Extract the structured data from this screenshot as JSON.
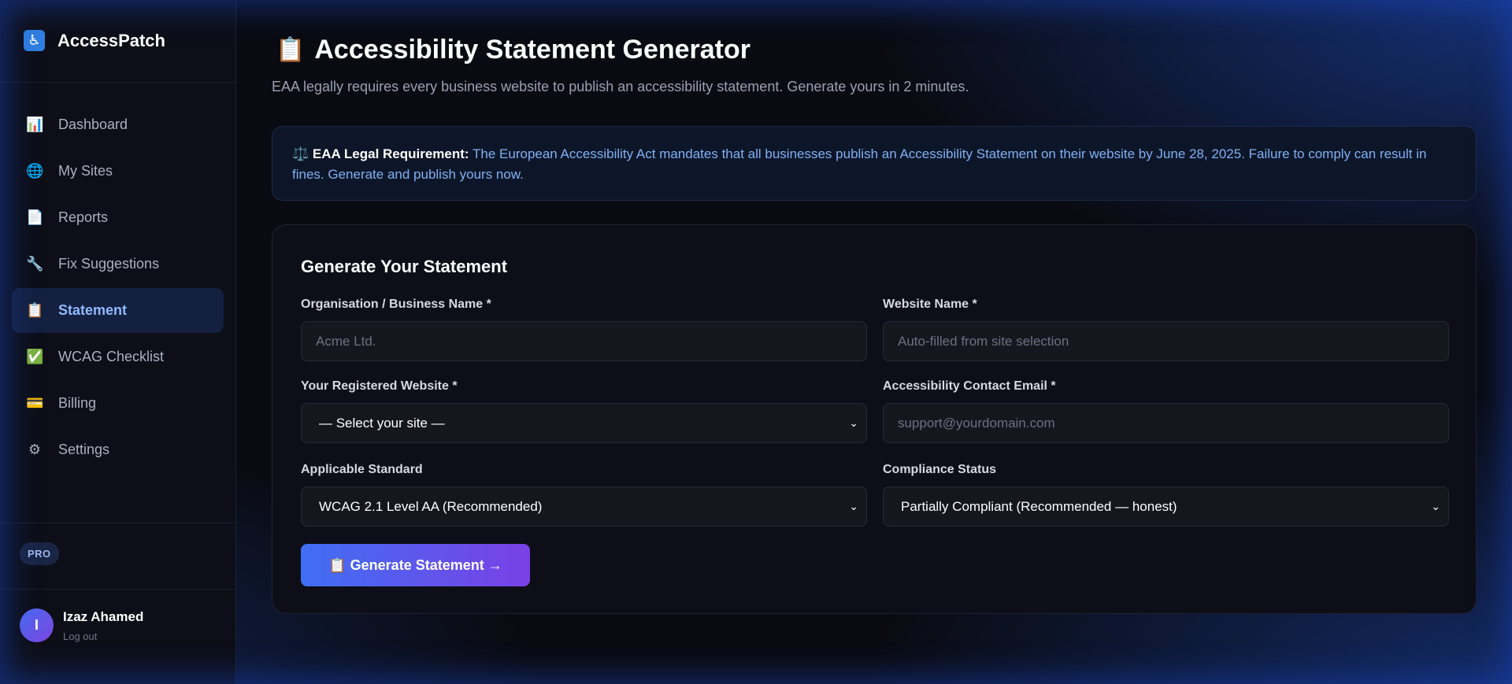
{
  "sidebar": {
    "brand": {
      "icon": "wheelchair-icon",
      "name": "AccessPatch"
    },
    "items": [
      {
        "label": "Dashboard",
        "icon": "chart-icon",
        "glyph": "📊",
        "active": false
      },
      {
        "label": "My Sites",
        "icon": "globe-icon",
        "glyph": "🌐",
        "active": false
      },
      {
        "label": "Reports",
        "icon": "document-icon",
        "glyph": "📄",
        "active": false
      },
      {
        "label": "Fix Suggestions",
        "icon": "wrench-icon",
        "glyph": "🔧",
        "active": false
      },
      {
        "label": "Statement",
        "icon": "clipboard-icon",
        "glyph": "📋",
        "active": true
      },
      {
        "label": "WCAG Checklist",
        "icon": "checkmark-icon",
        "glyph": "✅",
        "active": false
      },
      {
        "label": "Billing",
        "icon": "credit-card-icon",
        "glyph": "💳",
        "active": false
      },
      {
        "label": "Settings",
        "icon": "gear-icon",
        "glyph": "⚙",
        "active": false
      }
    ],
    "plan_badge": "PRO",
    "user": {
      "initial": "I",
      "name": "Izaz Ahamed",
      "logout": "Log out"
    }
  },
  "header": {
    "icon": "clipboard-icon",
    "title": "Accessibility Statement Generator",
    "subtitle": "EAA legally requires every business website to publish an accessibility statement. Generate yours in 2 minutes."
  },
  "notice": {
    "icon": "scales-icon",
    "label": "EAA Legal Requirement:",
    "text": "The European Accessibility Act mandates that all businesses publish an Accessibility Statement on their website by June 28, 2025. Failure to comply can result in fines. Generate and publish yours now."
  },
  "form": {
    "title": "Generate Your Statement",
    "org_name": {
      "label": "Organisation / Business Name *",
      "placeholder": "Acme Ltd.",
      "value": ""
    },
    "website_name": {
      "label": "Website Name *",
      "placeholder": "Auto-filled from site selection",
      "value": ""
    },
    "registered_website": {
      "label": "Your Registered Website *",
      "selected": "— Select your site —"
    },
    "contact_email": {
      "label": "Accessibility Contact Email *",
      "placeholder": "support@yourdomain.com",
      "value": ""
    },
    "standard": {
      "label": "Applicable Standard",
      "selected": "WCAG 2.1 Level AA (Recommended)"
    },
    "compliance": {
      "label": "Compliance Status",
      "selected": "Partially Compliant (Recommended — honest)"
    },
    "submit_label": "📋 Generate Statement →"
  },
  "colors": {
    "accent": "#3f6ff2",
    "accent_end": "#7a40e6",
    "active_nav_bg": "#142040",
    "active_nav_text": "#8fbaff",
    "notice_text": "#7fb0f5"
  }
}
